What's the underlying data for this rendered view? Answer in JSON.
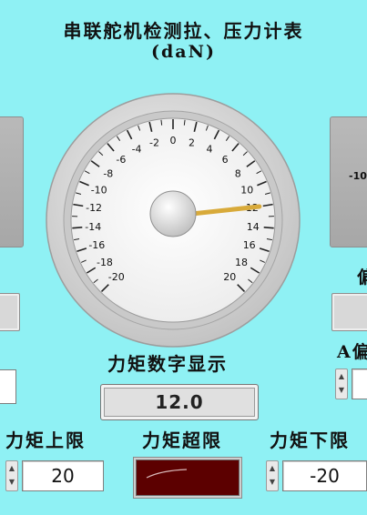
{
  "header": {
    "title_line1": "串联舵机检测拉、压力计表",
    "title_line2": "(daN)"
  },
  "gauge": {
    "ticks": [
      "-20",
      "-18",
      "-16",
      "-14",
      "-12",
      "-10",
      "-8",
      "-6",
      "-4",
      "-2",
      "0",
      "2",
      "4",
      "6",
      "8",
      "10",
      "12",
      "14",
      "16",
      "18",
      "20"
    ],
    "value": 12.0,
    "min": -20,
    "max": 20,
    "needle_color": "#d8aa3a"
  },
  "right_panel": {
    "partial_value": "-10",
    "partial_label_1": "偏",
    "partial_label_2": "A偏"
  },
  "torque_display": {
    "label": "力矩数字显示",
    "value": "12.0"
  },
  "upper_limit": {
    "label": "力矩上限",
    "value": "20"
  },
  "over_limit": {
    "label": "力矩超限",
    "led_color": "#5c0000"
  },
  "lower_limit": {
    "label": "力矩下限",
    "value": "-20"
  },
  "spin": {
    "up": "▲",
    "down": "▼"
  }
}
